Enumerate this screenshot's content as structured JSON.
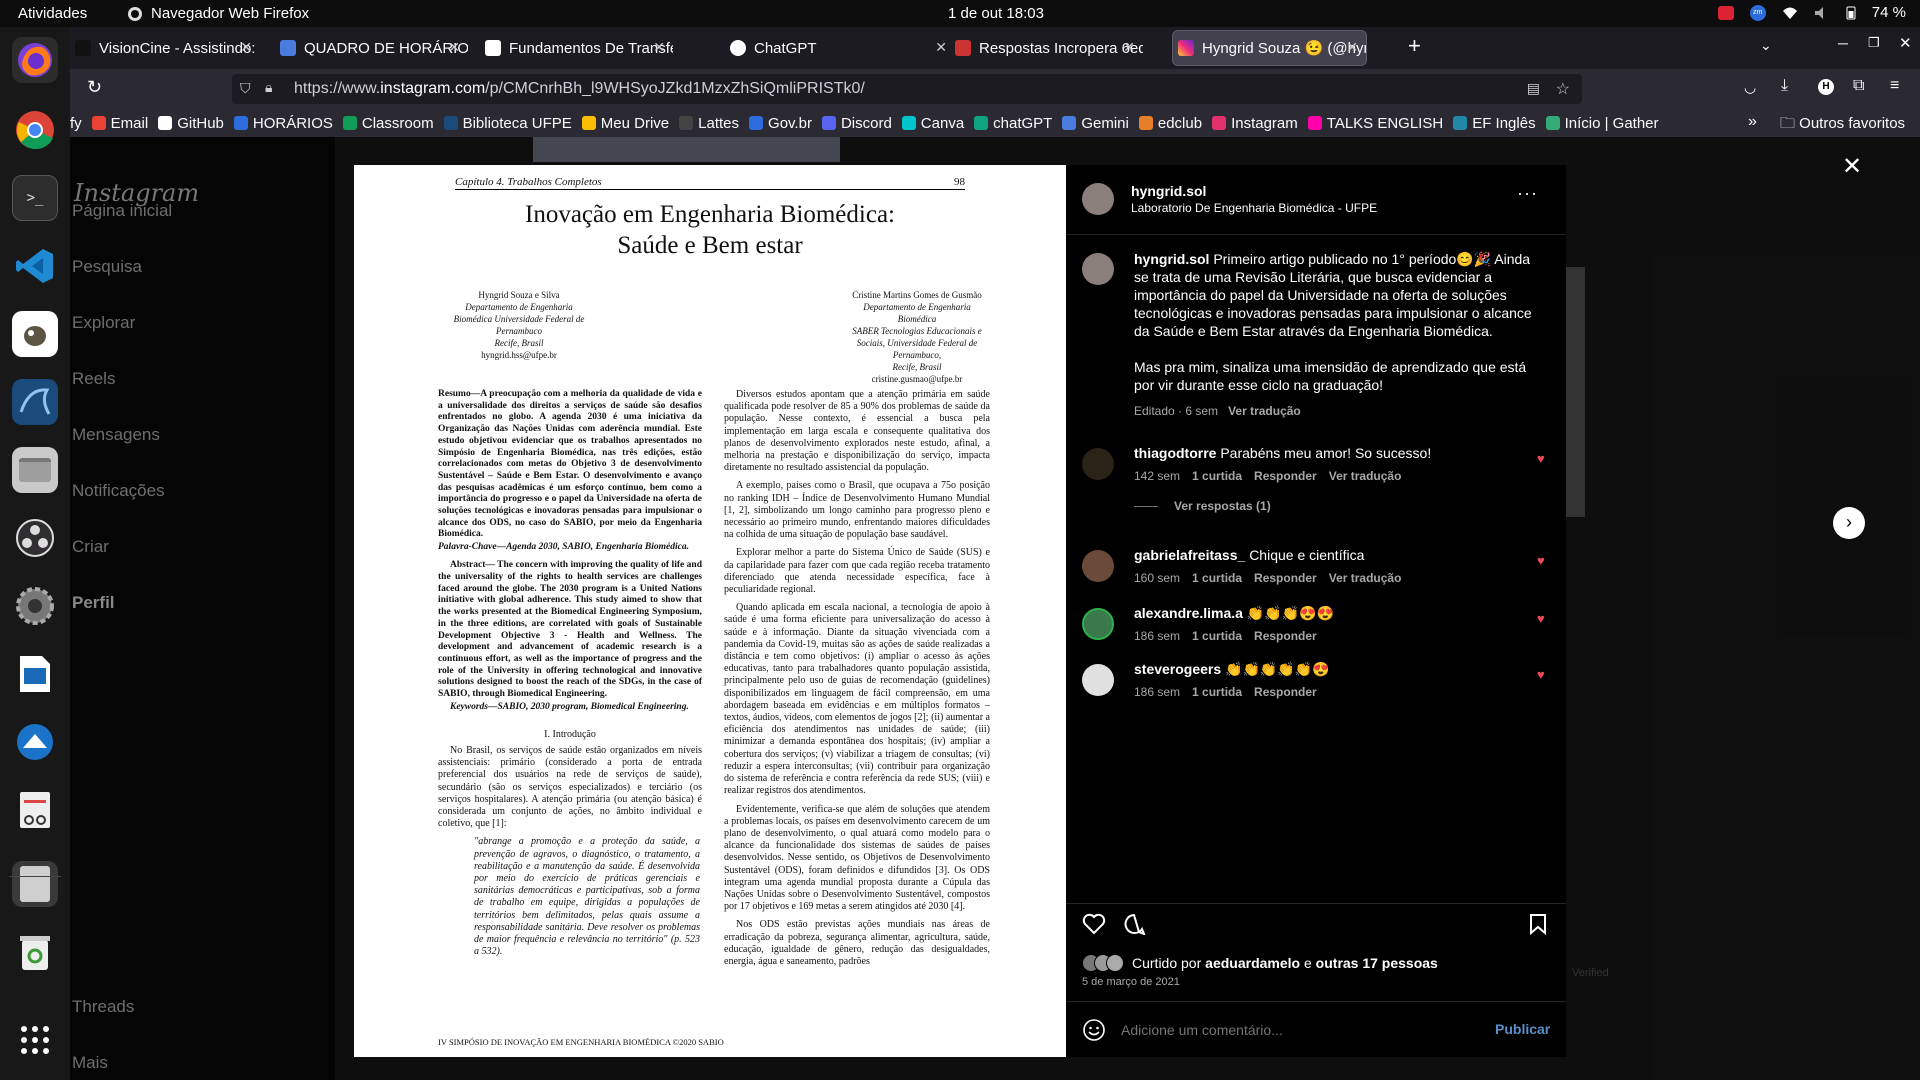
{
  "system": {
    "activities": "Atividades",
    "app": "Navegador Web Firefox",
    "clock": "1 de out  18:03",
    "battery": "74 %"
  },
  "tabs": [
    {
      "label": "VisionCine - Assistindo: C"
    },
    {
      "label": "QUADRO DE HORÁRIO - I"
    },
    {
      "label": "Fundamentos De Transfe"
    },
    {
      "label": "ChatGPT"
    },
    {
      "label": "Respostas Incropera 6ed"
    },
    {
      "label": "Hyngrid Souza 😉 (@hyng"
    }
  ],
  "url": {
    "prefix": "https://www.",
    "domain": "instagram.com",
    "path": "/p/CMCnrhBh_l9WHSyoJZkd1MzxZhSiQmliPRISTk0/"
  },
  "bookmarks": [
    "fy",
    "Email",
    "GitHub",
    "HORÁRIOS",
    "Classroom",
    "Biblioteca UFPE",
    "Meu Drive",
    "Lattes",
    "Gov.br",
    "Discord",
    "Canva",
    "chatGPT",
    "Gemini",
    "edclub",
    "Instagram",
    "TALKS ENGLISH",
    "EF Inglês",
    "Início | Gather"
  ],
  "bookmarks_more": "Outros favoritos",
  "ig": {
    "logo": "Instagram",
    "nav": [
      "Página inicial",
      "Pesquisa",
      "Explorar",
      "Reels",
      "Mensagens",
      "Notificações",
      "Criar",
      "Perfil"
    ],
    "threads": "Threads",
    "mais": "Mais",
    "verified": "Verified"
  },
  "paper": {
    "chapter": "Capítulo 4.  Trabalhos Completos",
    "page": "98",
    "title1": "Inovação em Engenharia Biomédica:",
    "title2": "Saúde e Bem estar",
    "author1": [
      "Hyngrid Souza e Silva",
      "Departamento de Engenharia",
      "Biomédica Universidade Federal de",
      "Pernambuco",
      "Recife, Brasil",
      "hyngrid.hss@ufpe.br"
    ],
    "author2": [
      "Cristine Martins Gomes de Gusmão",
      "Departamento de Engenharia",
      "Biomédica",
      "SABER Tecnologias Educacionais e",
      "Sociais, Universidade Federal de",
      "Pernambuco,",
      "Recife, Brasil",
      "cristine.gusmao@ufpe.br"
    ],
    "resumo": "Resumo—A preocupação com a melhoria da qualidade de vida e a universalidade dos direitos a serviços de saúde são desafios enfrentados no globo. A agenda 2030 é uma iniciativa da Organização das Nações Unidas com aderência mundial. Este estudo objetivou evidenciar que os trabalhos apresentados no Simpósio de Engenharia Biomédica, nas três edições, estão correlacionados com metas do Objetivo 3 de desenvolvimento Sustentável – Saúde e Bem Estar. O desenvolvimento e avanço das pesquisas acadêmicas é um esforço contínuo, bem como a importância do progresso e o papel da Universidade na oferta de soluções tecnológicas e inovadoras pensadas para impulsionar o alcance dos ODS, no caso do SABIO, por meio da Engenharia Biomédica.",
    "palavras": "Palavra-Chave—Agenda 2030, SABIO, Engenharia Biomédica.",
    "abstract": "Abstract— The concern with improving the quality of life and the universality of the rights to health services are challenges faced around the globe. The 2030 program is a United Nations initiative with global adherence. This study aimed to show that the works presented at the Biomedical Engineering Symposium, in the three editions, are correlated with goals of Sustainable Development Objective 3 - Health and Wellness. The development and advancement of academic research is a continuous effort, as well as the importance of progress and the role of the University in offering technological and innovative solutions designed to boost the reach of the SDGs, in the case of SABIO, through Biomedical Engineering.",
    "keywords": "Keywords—SABIO, 2030 program, Biomedical Engineering.",
    "section": "I.    Introdução",
    "intro": "No Brasil, os serviços de saúde estão organizados em níveis assistenciais: primário (considerado a porta de entrada preferencial dos usuários na rede de serviços de saúde), secundário (são os serviços especializados) e terciário (os serviços hospitalares). A atenção primária (ou atenção básica) é considerada um conjunto de ações, no âmbito individual e coletivo, que [1]:",
    "quote": "\"abrange a promoção e a proteção da saúde, a prevenção de agravos, o diagnóstico, o tratamento, a reabilitação e a manutenção da saúde. É desenvolvida por meio do exercício de práticas gerenciais e sanitárias democráticas e participativas, sob a forma de trabalho em equipe, dirigidas a populações de territórios bem delimitados, pelas quais assume a responsabilidade sanitária. Deve resolver os problemas de maior frequência e relevância no território\" (p. 523 a 532).",
    "col2": [
      "Diversos estudos apontam que a atenção primária em saúde qualificada pode resolver de 85 a 90% dos problemas de saúde da população. Nesse contexto, é essencial a busca pela implementação em larga escala e consequente qualitativa dos planos de desenvolvimento explorados neste estudo, afinal, a melhoria na prestação e disponibilização do serviço, impacta diretamente no resultado assistencial da população.",
      "A exemplo, países como o Brasil, que ocupava a 75o posição no ranking IDH – Índice de Desenvolvimento Humano Mundial [1, 2], simbolizando um longo caminho para progresso pleno e necessário ao primeiro mundo, enfrentando maiores dificuldades na colhida de uma situação de população base saudável.",
      "Explorar melhor a parte do Sistema Único de Saúde (SUS) e da capilaridade para fazer com que cada região receba tratamento diferenciado que atenda necessidade específica, face à peculiaridade regional.",
      "Quando aplicada em escala nacional, a tecnologia de apoio à saúde é uma forma eficiente para universalização do acesso à saúde e à informação. Diante da situação vivenciada com a pandemia da Covid-19, muitas são as ações de saúde realizadas a distância e tem como objetivos: (i) ampliar o acesso às ações educativas, tanto para trabalhadores quanto população assistida, principalmente pelo uso de guias de recomendação (guidelines) disponibilizados em linguagem de fácil compreensão, em uma abordagem baseada em evidências e em múltiplos formatos – textos, áudios, vídeos, com elementos de jogos [2]; (ii) aumentar a eficiência dos atendimentos nas unidades de saúde; (iii) minimizar a demanda espontânea dos hospitais; (iv) ampliar a cobertura dos serviços; (v) viabilizar a triagem de consultas; (vi) reduzir a espera interconsultas; (vii) contribuir para organização do sistema de referência e contra referência da rede SUS; (viii) e realizar registros dos atendimentos.",
      "Evidentemente, verifica-se que além de soluções que atendem a problemas locais, os países em desenvolvimento carecem de um plano de desenvolvimento, o qual atuará como modelo para o alcance da funcionalidade dos sistemas de saúdes de países desenvolvidos. Nesse sentido, os Objetivos de Desenvolvimento Sustentável (ODS), foram definidos e difundidos [3]. Os ODS integram uma agenda mundial proposta durante a Cúpula das Nações Unidas sobre o Desenvolvimento Sustentável, compostos por 17 objetivos e 169 metas a serem atingidos até 2030 [4].",
      "Nos ODS estão previstas ações mundiais nas áreas de erradicação da pobreza, segurança alimentar, agricultura, saúde, educação, igualdade de gênero, redução das desigualdades, energia, água e saneamento, padrões"
    ],
    "footer": "IV SIMPÓSIO DE INOVAÇÃO EM ENGENHARIA BIOMÉDICA ©2020 SABIO"
  },
  "post": {
    "username": "hyngrid.sol",
    "location": "Laboratorio De Engenharia Biomédica - UFPE",
    "caption": "Primeiro artigo publicado no 1° período😊🎉 Ainda se trata de uma Revisão Literária, que busca evidenciar a importância do papel da Universidade na oferta de soluções tecnológicas e inovadoras pensadas para impulsionar o alcance da Saúde e Bem Estar através da Engenharia Biomédica.",
    "caption2": "Mas pra mim, sinaliza uma imensidão de aprendizado que está por vir durante esse ciclo na graduação!",
    "caption_meta": "Editado · 6 sem",
    "translate": "Ver tradução",
    "comments": [
      {
        "user": "thiagodtorre",
        "text": "Parabéns meu amor! So sucesso!",
        "time": "142 sem",
        "likes": "1 curtida",
        "reply": "Responder",
        "translate": "Ver tradução",
        "replies": "Ver respostas (1)"
      },
      {
        "user": "gabrielafreitass_",
        "text": "Chique e científica",
        "time": "160 sem",
        "likes": "1 curtida",
        "reply": "Responder",
        "translate": "Ver tradução"
      },
      {
        "user": "alexandre.lima.a",
        "text": "👏👏👏😍😍",
        "time": "186 sem",
        "likes": "1 curtida",
        "reply": "Responder"
      },
      {
        "user": "steverogeers",
        "text": "👏👏👏👏👏😍",
        "time": "186 sem",
        "likes": "1 curtida",
        "reply": "Responder"
      }
    ],
    "liked_prefix": "Curtido por",
    "liked_user": "aeduardamelo",
    "liked_and": "e",
    "liked_others": "outras 17 pessoas",
    "date": "5 de março de 2021",
    "comment_placeholder": "Adicione um comentário...",
    "publish": "Publicar"
  }
}
